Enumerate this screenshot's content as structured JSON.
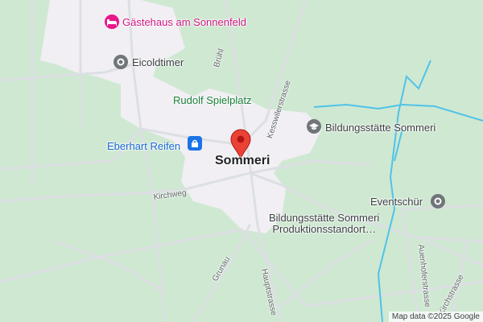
{
  "map": {
    "town": "Sommeri",
    "pois": {
      "guesthouse": "Gästehaus am Sonnenfeld",
      "eicoldtimer": "Eicoldtimer",
      "playground": "Rudolf Spielplatz",
      "tires": "Eberhart Reifen",
      "education": "Bildungsstätte Sommeri",
      "events": "Eventschür",
      "production_line1": "Bildungsstätte Sommeri",
      "production_line2": "Produktionsstandort…"
    },
    "streets": {
      "bruehl": "Brühl",
      "kesswiler": "Kesswilerstrasse",
      "kirchweg": "Kirchweg",
      "grunau": "Grunau",
      "haupt": "Hauptstrasse",
      "auenhof": "Auenhoferstrasse",
      "kirchstrasse": "Kirchstrasse"
    },
    "attribution": "Map data ©2025 Google",
    "colors": {
      "land": "#cfe8d2",
      "town_area": "#f1eff3",
      "road": "#dcdfe3",
      "water": "#4fc3e8",
      "marker": "#ea4335",
      "poi_gray": "#70757a",
      "poi_pink": "#e8178a",
      "poi_blue": "#1a73e8"
    }
  }
}
